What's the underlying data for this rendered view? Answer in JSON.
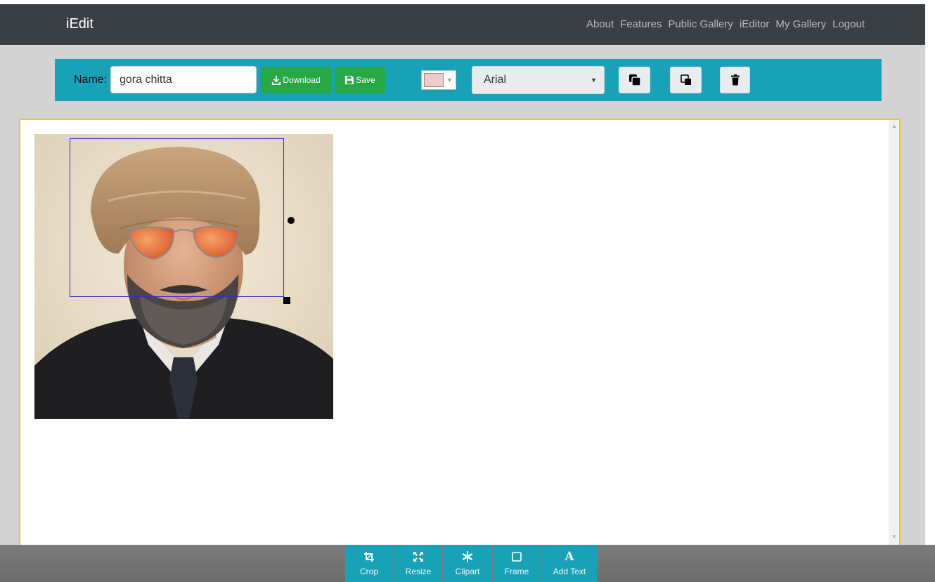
{
  "navbar": {
    "brand": "iEdit",
    "links": [
      "About",
      "Features",
      "Public Gallery",
      "iEditor",
      "My Gallery",
      "Logout"
    ]
  },
  "toolbar": {
    "name_label": "Name:",
    "name_value": "gora chitta",
    "download_label": "Download",
    "save_label": "Save",
    "color_value": "#f2c9cb",
    "font_value": "Arial",
    "icons": [
      "bring-to-front-icon",
      "send-to-back-icon",
      "trash-icon"
    ]
  },
  "bottom_tools": [
    {
      "label": "Crop",
      "icon": "crop-icon"
    },
    {
      "label": "Resize",
      "icon": "expand-arrows-icon"
    },
    {
      "label": "Clipart",
      "icon": "asterisk-icon"
    },
    {
      "label": "Frame",
      "icon": "square-outline-icon"
    },
    {
      "label": "Add Text",
      "icon": "letter-a-icon",
      "glyph": "A"
    }
  ],
  "colors": {
    "navbar": "#3a3f44",
    "toolbar": "#17a2b8",
    "button_green": "#28a745",
    "canvas_border": "#f5c518",
    "selection": "#2d2dd0"
  }
}
